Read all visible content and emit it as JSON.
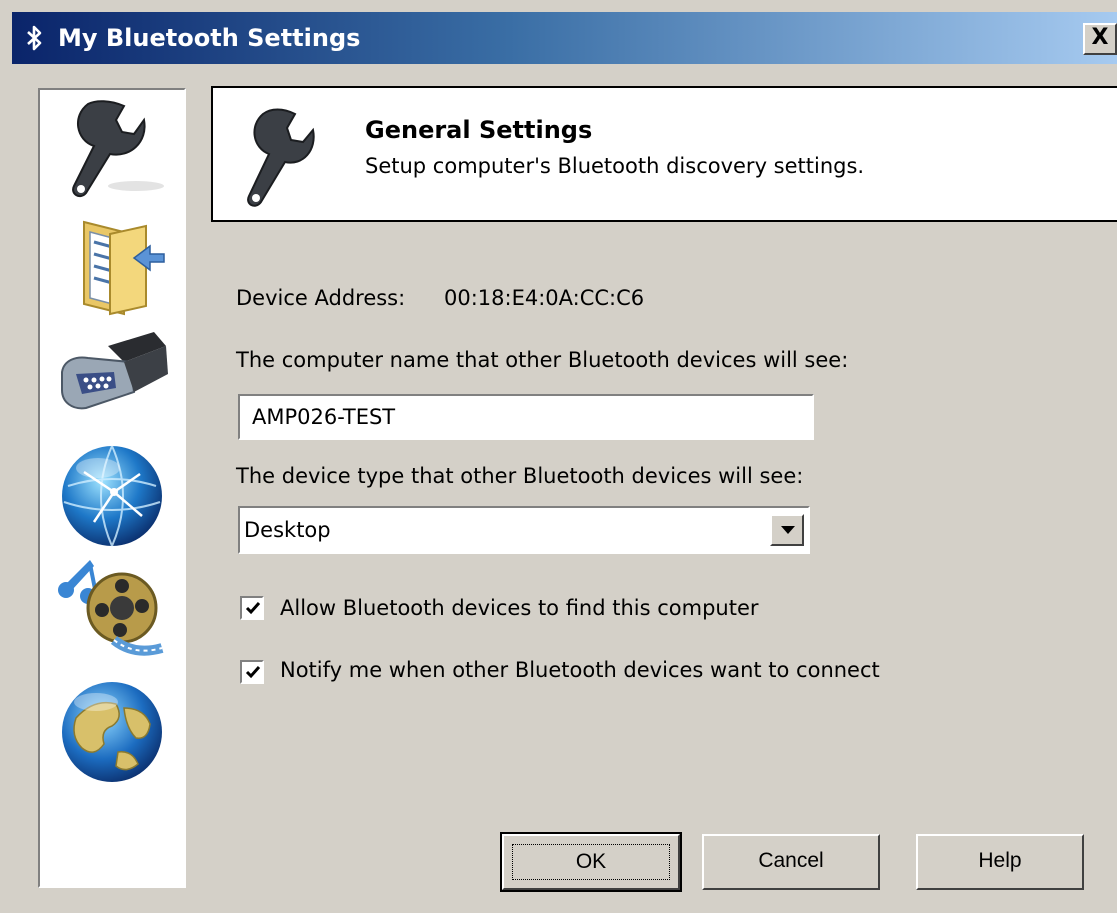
{
  "window": {
    "title": "My Bluetooth Settings",
    "title_icon": "bluetooth-icon",
    "close_label": "X"
  },
  "sidebar": {
    "items": [
      {
        "icon": "wrench-icon"
      },
      {
        "icon": "folder-transfer-icon"
      },
      {
        "icon": "serial-port-icon"
      },
      {
        "icon": "network-globe-icon"
      },
      {
        "icon": "music-film-icon"
      },
      {
        "icon": "world-globe-icon"
      }
    ]
  },
  "header": {
    "icon": "wrench-icon",
    "title": "General Settings",
    "subtitle": "Setup computer's Bluetooth discovery settings."
  },
  "form": {
    "device_address_label": "Device Address:",
    "device_address_value": "00:18:E4:0A:CC:C6",
    "computer_name_label": "The computer name that other Bluetooth devices will see:",
    "computer_name_value": "AMP026-TEST",
    "device_type_label": "The device type that other Bluetooth devices will see:",
    "device_type_value": "Desktop",
    "allow_find_label": "Allow Bluetooth devices to find this computer",
    "allow_find_checked": true,
    "notify_label": "Notify me when other Bluetooth devices want to connect",
    "notify_checked": true
  },
  "buttons": {
    "ok": "OK",
    "cancel": "Cancel",
    "help": "Help"
  }
}
